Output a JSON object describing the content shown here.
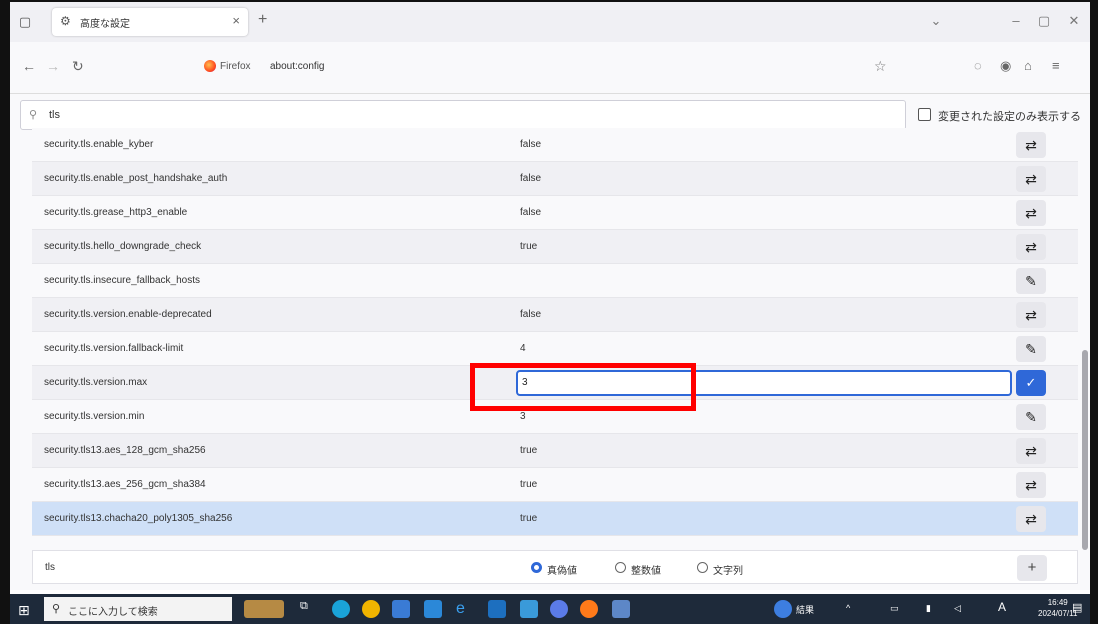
{
  "browser": {
    "tab_title": "高度な設定",
    "url_label": "Firefox",
    "url": "about:config"
  },
  "search": {
    "value": "tls",
    "modified_only_label": "変更された設定のみ表示する"
  },
  "prefs": [
    {
      "name": "security.tls.enable_kyber",
      "value": "false",
      "action": "toggle"
    },
    {
      "name": "security.tls.enable_post_handshake_auth",
      "value": "false",
      "action": "toggle"
    },
    {
      "name": "security.tls.grease_http3_enable",
      "value": "false",
      "action": "toggle"
    },
    {
      "name": "security.tls.hello_downgrade_check",
      "value": "true",
      "action": "toggle"
    },
    {
      "name": "security.tls.insecure_fallback_hosts",
      "value": "",
      "action": "edit"
    },
    {
      "name": "security.tls.version.enable-deprecated",
      "value": "false",
      "action": "toggle"
    },
    {
      "name": "security.tls.version.fallback-limit",
      "value": "4",
      "action": "edit"
    },
    {
      "name": "security.tls.version.max",
      "value": "3",
      "action": "save",
      "editing": true
    },
    {
      "name": "security.tls.version.min",
      "value": "3",
      "action": "edit"
    },
    {
      "name": "security.tls13.aes_128_gcm_sha256",
      "value": "true",
      "action": "toggle"
    },
    {
      "name": "security.tls13.aes_256_gcm_sha384",
      "value": "true",
      "action": "toggle"
    },
    {
      "name": "security.tls13.chacha20_poly1305_sha256",
      "value": "true",
      "action": "toggle",
      "selected": true
    }
  ],
  "add_row": {
    "name": "tls",
    "types": [
      "真偽値",
      "整数値",
      "文字列"
    ],
    "selected_type": "真偽値"
  },
  "taskbar": {
    "search_placeholder": "ここに入力して検索",
    "weather": "結果",
    "time": "16:49",
    "date": "2024/07/11"
  },
  "colors": {
    "accent": "#2f68d8",
    "highlight": "#ff0000",
    "selected_row": "#cfe0f7"
  }
}
